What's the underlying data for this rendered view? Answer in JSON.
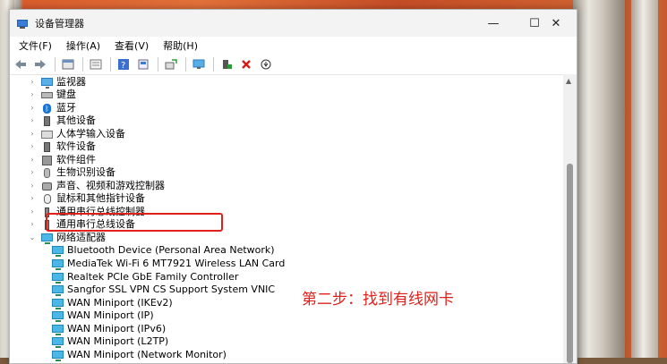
{
  "window": {
    "title": "设备管理器",
    "minimize": "—",
    "maximize": "☐",
    "close": "✕"
  },
  "menu": [
    "文件(F)",
    "操作(A)",
    "查看(V)",
    "帮助(H)"
  ],
  "toolbar": {
    "icons": [
      "back-arrow-icon",
      "forward-arrow-icon",
      "properties-icon",
      "device-list-icon",
      "help-icon",
      "update-driver-icon",
      "scan-hardware-icon",
      "add-device-icon",
      "uninstall-icon",
      "disable-icon"
    ]
  },
  "tree": {
    "categories": [
      {
        "label": "监视器",
        "icon": "monitor-icon"
      },
      {
        "label": "键盘",
        "icon": "keyboard-icon"
      },
      {
        "label": "蓝牙",
        "icon": "bluetooth-icon"
      },
      {
        "label": "其他设备",
        "icon": "other-devices-icon"
      },
      {
        "label": "人体学输入设备",
        "icon": "hid-icon"
      },
      {
        "label": "软件设备",
        "icon": "software-device-icon"
      },
      {
        "label": "软件组件",
        "icon": "software-component-icon"
      },
      {
        "label": "生物识别设备",
        "icon": "biometric-icon"
      },
      {
        "label": "声音、视频和游戏控制器",
        "icon": "sound-icon"
      },
      {
        "label": "鼠标和其他指针设备",
        "icon": "mouse-icon"
      },
      {
        "label": "通用串行总线控制器",
        "icon": "usb-controller-icon"
      },
      {
        "label": "通用串行总线设备",
        "icon": "usb-device-icon"
      },
      {
        "label": "网络适配器",
        "icon": "network-adapter-icon",
        "expanded": true
      }
    ],
    "adapters": [
      "Bluetooth Device (Personal Area Network)",
      "MediaTek Wi-Fi 6 MT7921 Wireless LAN Card",
      "Realtek PCIe GbE Family Controller",
      "Sangfor SSL VPN CS Support System VNIC",
      "WAN Miniport (IKEv2)",
      "WAN Miniport (IP)",
      "WAN Miniport (IPv6)",
      "WAN Miniport (L2TP)",
      "WAN Miniport (Network Monitor)"
    ]
  },
  "annotation": "第二步：找到有线网卡",
  "colors": {
    "highlight": "#e0201a",
    "accent": "#2b7bc0"
  }
}
